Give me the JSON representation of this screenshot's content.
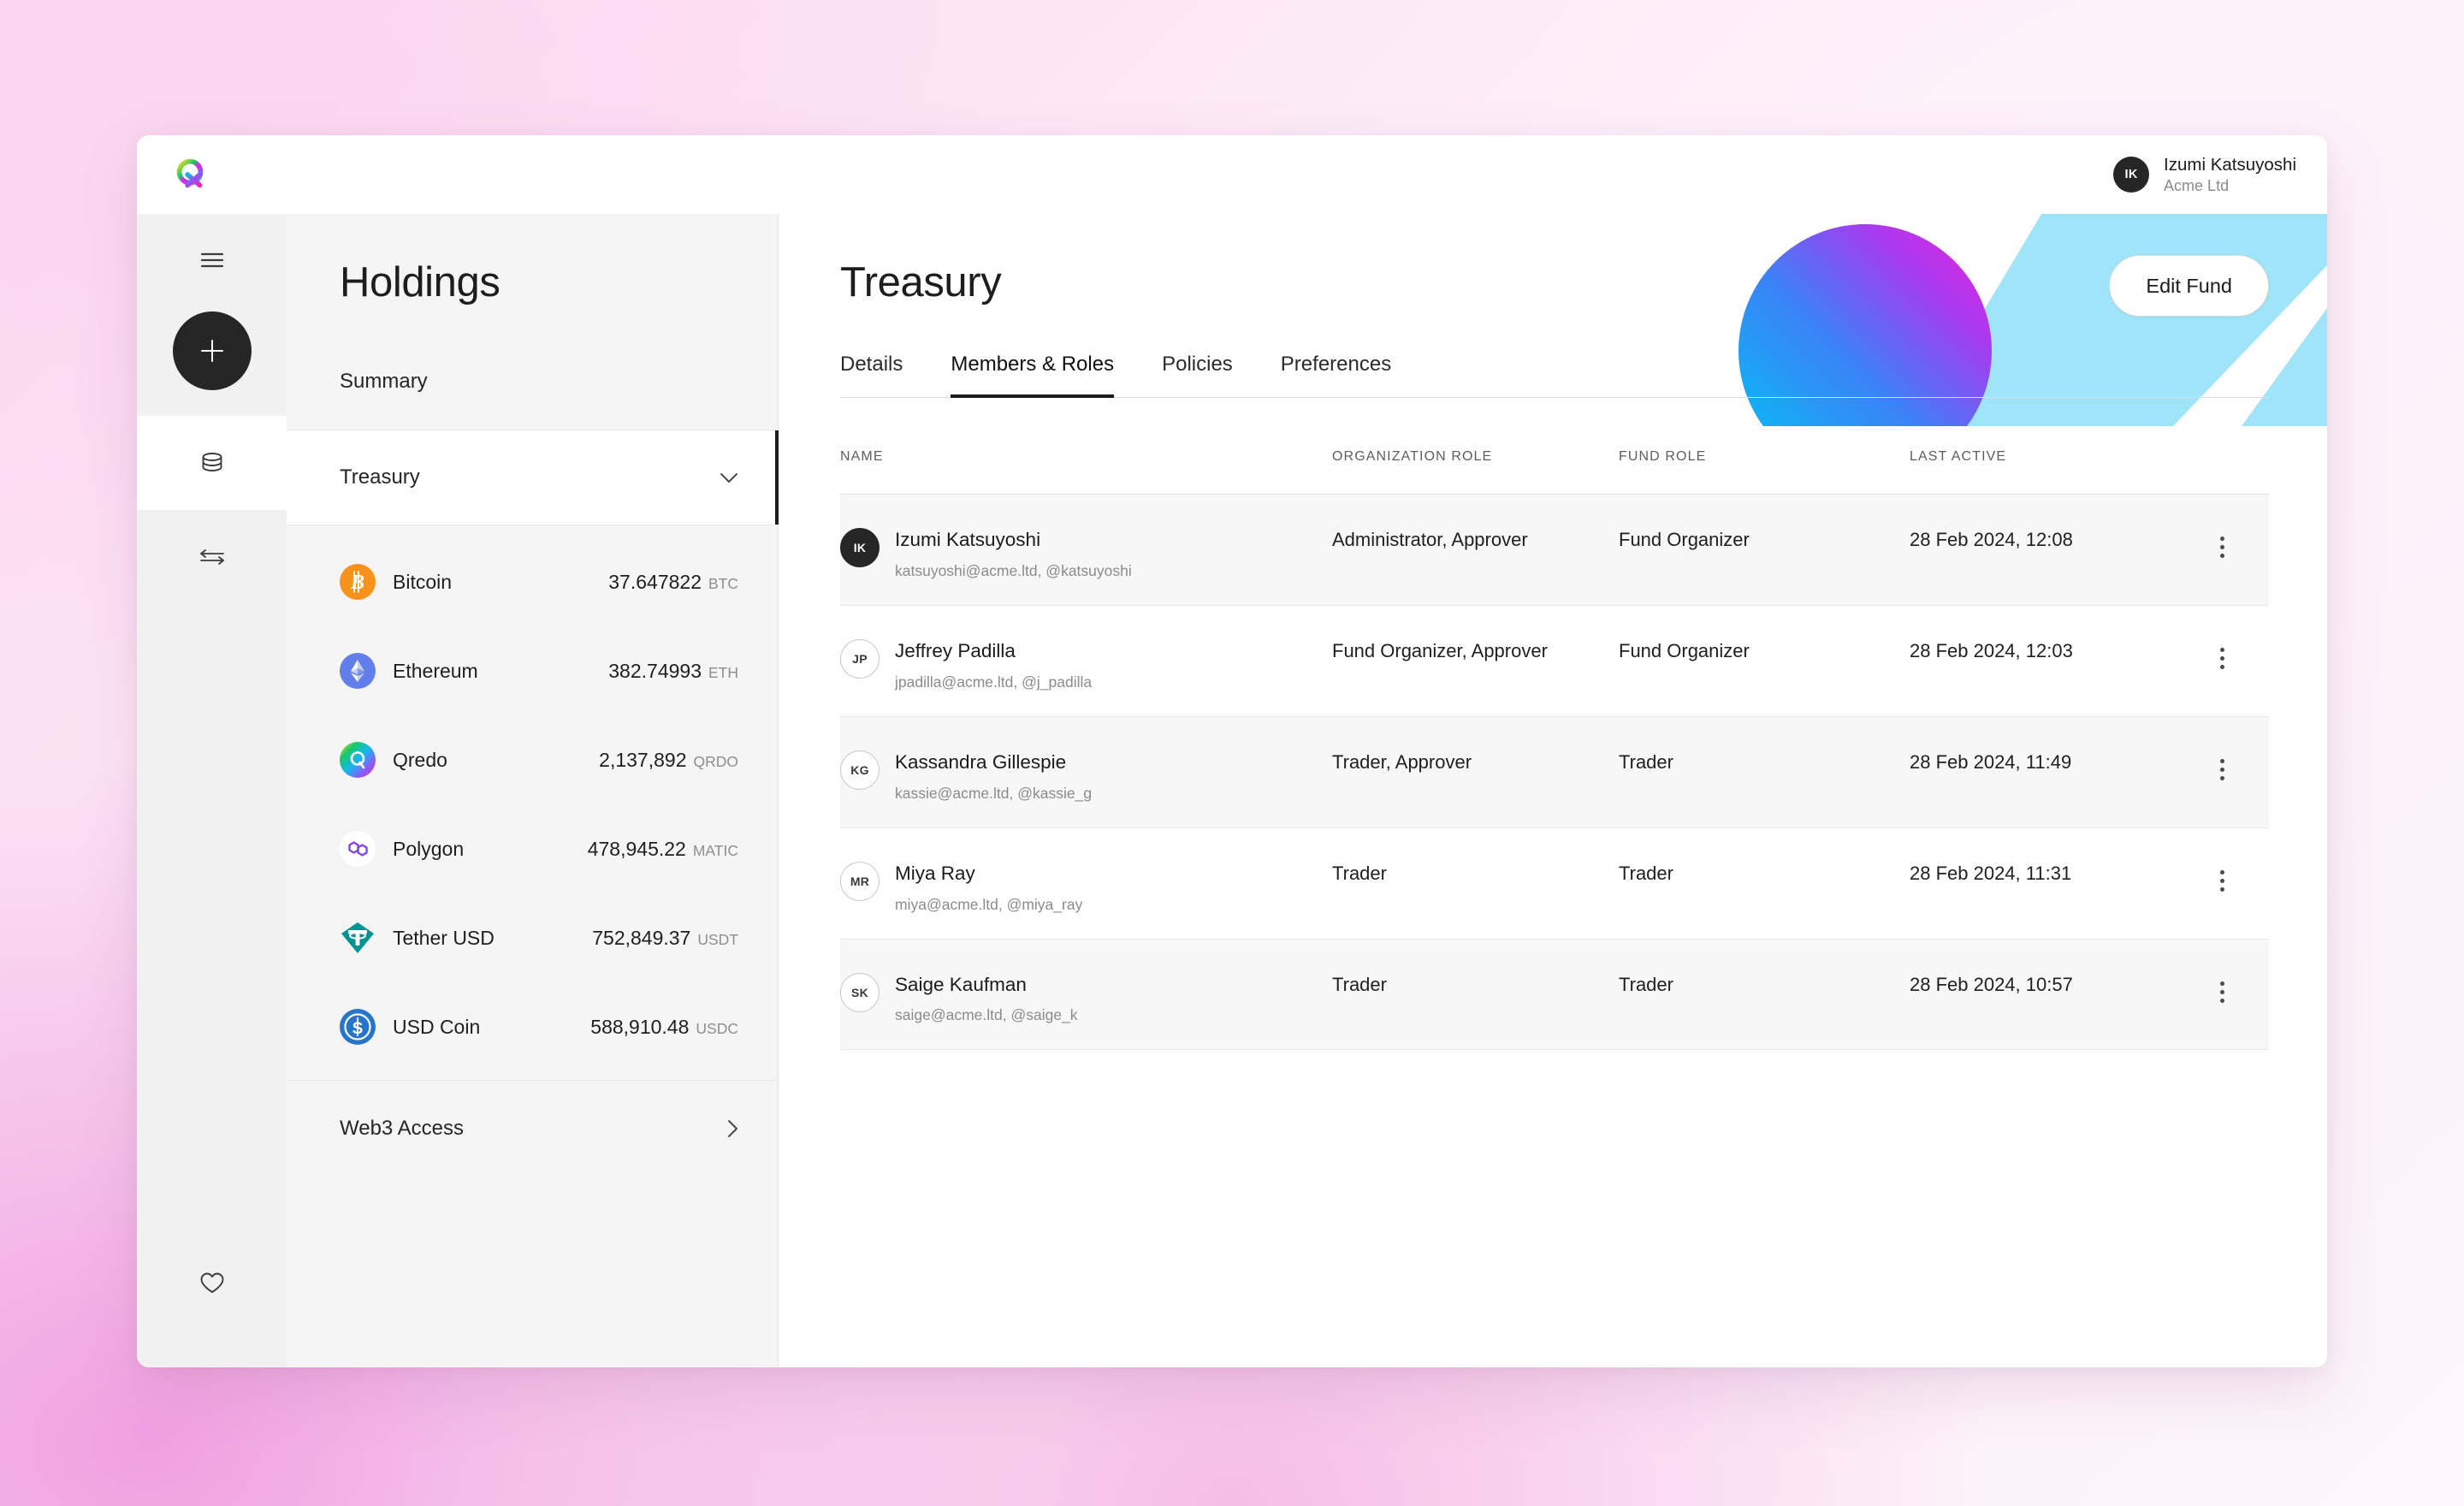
{
  "brand": {
    "logo_icon": "qredo-q-logo"
  },
  "user": {
    "initials": "IK",
    "name": "Izumi Katsuyoshi",
    "org": "Acme Ltd"
  },
  "rail": {
    "items": [
      {
        "icon": "hamburger-menu-icon",
        "name": "menu"
      },
      {
        "icon": "plus-icon",
        "name": "add"
      },
      {
        "icon": "database-icon",
        "name": "holdings",
        "active": true
      },
      {
        "icon": "swap-arrows-icon",
        "name": "transfers"
      },
      {
        "icon": "heart-icon",
        "name": "favourites"
      }
    ]
  },
  "holdings": {
    "title": "Holdings",
    "summary_label": "Summary",
    "treasury_label": "Treasury",
    "treasury_chevron": "chevron-down-icon",
    "web3_label": "Web3 Access",
    "web3_chevron": "chevron-right-icon",
    "coins": [
      {
        "icon": "bitcoin-icon",
        "name": "Bitcoin",
        "amount": "37.647822",
        "symbol": "BTC"
      },
      {
        "icon": "ethereum-icon",
        "name": "Ethereum",
        "amount": "382.74993",
        "symbol": "ETH"
      },
      {
        "icon": "qredo-icon",
        "name": "Qredo",
        "amount": "2,137,892",
        "symbol": "QRDO"
      },
      {
        "icon": "polygon-icon",
        "name": "Polygon",
        "amount": "478,945.22",
        "symbol": "MATIC"
      },
      {
        "icon": "tether-icon",
        "name": "Tether USD",
        "amount": "752,849.37",
        "symbol": "USDT"
      },
      {
        "icon": "usdcoin-icon",
        "name": "USD Coin",
        "amount": "588,910.48",
        "symbol": "USDC"
      }
    ]
  },
  "main": {
    "title": "Treasury",
    "edit_fund_label": "Edit Fund",
    "tabs": [
      {
        "label": "Details",
        "active": false
      },
      {
        "label": "Members & Roles",
        "active": true
      },
      {
        "label": "Policies",
        "active": false
      },
      {
        "label": "Preferences",
        "active": false
      }
    ],
    "table": {
      "columns": [
        "NAME",
        "ORGANIZATION ROLE",
        "FUND ROLE",
        "LAST ACTIVE"
      ],
      "rows": [
        {
          "initials": "IK",
          "avatar_dark": true,
          "name": "Izumi Katsuyoshi",
          "contact": "katsuyoshi@acme.ltd, @katsuyoshi",
          "org_role": "Administrator, Approver",
          "fund_role": "Fund Organizer",
          "last_active": "28 Feb 2024, 12:08"
        },
        {
          "initials": "JP",
          "avatar_dark": false,
          "name": "Jeffrey Padilla",
          "contact": "jpadilla@acme.ltd, @j_padilla",
          "org_role": "Fund Organizer, Approver",
          "fund_role": "Fund Organizer",
          "last_active": "28 Feb 2024, 12:03"
        },
        {
          "initials": "KG",
          "avatar_dark": false,
          "name": "Kassandra Gillespie",
          "contact": "kassie@acme.ltd, @kassie_g",
          "org_role": "Trader, Approver",
          "fund_role": "Trader",
          "last_active": "28 Feb 2024, 11:49"
        },
        {
          "initials": "MR",
          "avatar_dark": false,
          "name": "Miya Ray",
          "contact": "miya@acme.ltd, @miya_ray",
          "org_role": "Trader",
          "fund_role": "Trader",
          "last_active": "28 Feb 2024, 11:31"
        },
        {
          "initials": "SK",
          "avatar_dark": false,
          "name": "Saige Kaufman",
          "contact": "saige@acme.ltd, @saige_k",
          "org_role": "Trader",
          "fund_role": "Trader",
          "last_active": "28 Feb 2024, 10:57"
        }
      ],
      "row_menu_icon": "kebab-menu-icon"
    }
  },
  "colors": {
    "accent_dark": "#262626",
    "panel_bg": "#f5f5f5",
    "rail_bg": "#f1f1f1",
    "row_stripe": "#f7f7f7",
    "deco_band": "#9fe4f8",
    "deco_circle_from": "#00b9f1",
    "deco_circle_to": "#e81ee8",
    "bitcoin": "#f7931a",
    "ethereum": "#627eea",
    "polygon": "#8247e5",
    "tether": "#009393",
    "usdcoin": "#2775ca"
  }
}
